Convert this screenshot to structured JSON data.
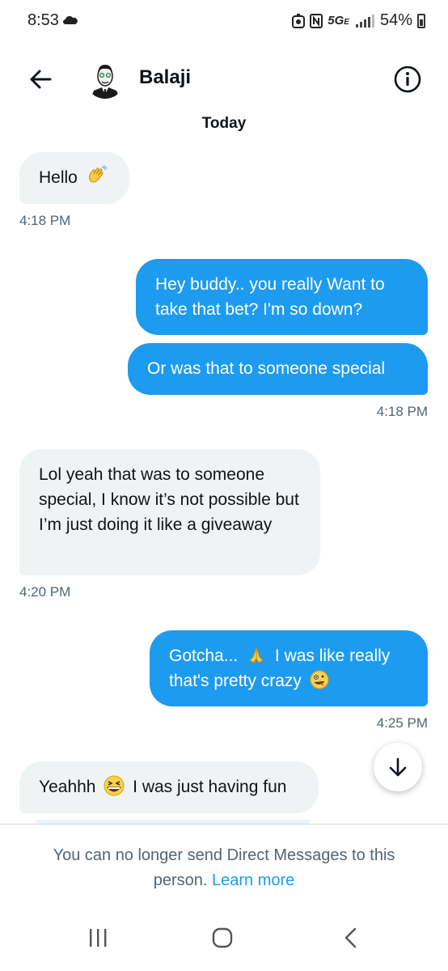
{
  "status_bar": {
    "time": "8:53",
    "network": "5G",
    "network_sub": "E",
    "battery": "54%",
    "icons": [
      "cloud-icon",
      "data-saver-icon",
      "nfc-icon",
      "signal-icon",
      "battery-icon"
    ]
  },
  "header": {
    "title": "Balaji",
    "back_icon": "arrow-left-icon",
    "info_icon": "info-circle-icon"
  },
  "day_separator": "Today",
  "messages": [
    {
      "direction": "in",
      "text": "Hello",
      "emoji": "waving-hand"
    },
    {
      "time": "4:18 PM"
    },
    {
      "direction": "out",
      "text": "Hey buddy.. you really Want to take that bet? I'm so down?"
    },
    {
      "direction": "out",
      "text": "Or was that to someone special"
    },
    {
      "time": "4:18 PM"
    },
    {
      "direction": "in",
      "text": "Lol yeah that was to someone special, I know it’s not possible but I’m just doing it like a giveaway"
    },
    {
      "time": "4:20 PM"
    },
    {
      "direction": "out",
      "text_a": "Gotcha...",
      "emoji_a": "folded-hands",
      "text_b": "I was like really that's pretty crazy",
      "emoji_b": "zany-face"
    },
    {
      "time": "4:25 PM"
    },
    {
      "direction": "in",
      "text_a": "Yeahhh",
      "emoji_a": "grinning-squinting-face",
      "text_b": "I was just having fun"
    }
  ],
  "scroll_down_icon": "arrow-down-icon",
  "footer": {
    "notice": "You can no longer send Direct Messages to this person.",
    "link": "Learn more"
  },
  "nav_bar": {
    "icons": [
      "recents-icon",
      "home-icon",
      "back-icon"
    ]
  },
  "colors": {
    "accent": "#1d9bf0",
    "incoming_bubble": "#eff3f4",
    "secondary_text": "#536471"
  }
}
